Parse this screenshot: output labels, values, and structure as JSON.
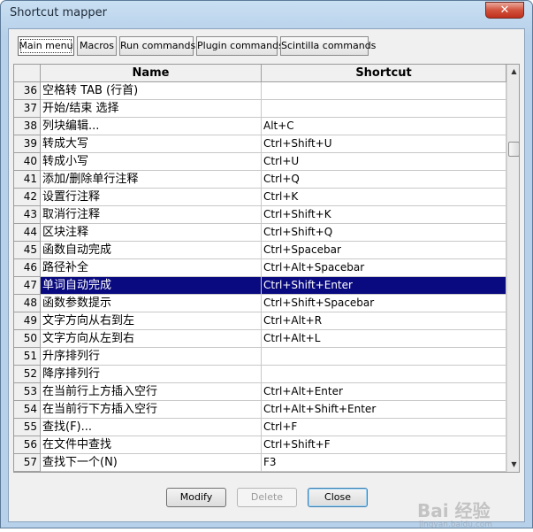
{
  "window": {
    "title": "Shortcut mapper",
    "close_glyph": "✕"
  },
  "tabs": [
    {
      "label": "Main menu",
      "active": true
    },
    {
      "label": "Macros"
    },
    {
      "label": "Run commands"
    },
    {
      "label": "Plugin commands"
    },
    {
      "label": "Scintilla commands"
    }
  ],
  "table": {
    "headers": {
      "name": "Name",
      "shortcut": "Shortcut"
    },
    "selected_row": "47",
    "rows": [
      {
        "num": "36",
        "name": "空格转 TAB (行首)",
        "shortcut": ""
      },
      {
        "num": "37",
        "name": "开始/结束 选择",
        "shortcut": ""
      },
      {
        "num": "38",
        "name": "列块编辑...",
        "shortcut": "Alt+C"
      },
      {
        "num": "39",
        "name": "转成大写",
        "shortcut": "Ctrl+Shift+U"
      },
      {
        "num": "40",
        "name": "转成小写",
        "shortcut": "Ctrl+U"
      },
      {
        "num": "41",
        "name": "添加/删除单行注释",
        "shortcut": "Ctrl+Q"
      },
      {
        "num": "42",
        "name": "设置行注释",
        "shortcut": "Ctrl+K"
      },
      {
        "num": "43",
        "name": "取消行注释",
        "shortcut": "Ctrl+Shift+K"
      },
      {
        "num": "44",
        "name": "区块注释",
        "shortcut": "Ctrl+Shift+Q"
      },
      {
        "num": "45",
        "name": "函数自动完成",
        "shortcut": "Ctrl+Spacebar"
      },
      {
        "num": "46",
        "name": "路径补全",
        "shortcut": "Ctrl+Alt+Spacebar"
      },
      {
        "num": "47",
        "name": "单词自动完成",
        "shortcut": "Ctrl+Shift+Enter"
      },
      {
        "num": "48",
        "name": "函数参数提示",
        "shortcut": "Ctrl+Shift+Spacebar"
      },
      {
        "num": "49",
        "name": "文字方向从右到左",
        "shortcut": "Ctrl+Alt+R"
      },
      {
        "num": "50",
        "name": "文字方向从左到右",
        "shortcut": "Ctrl+Alt+L"
      },
      {
        "num": "51",
        "name": "升序排列行",
        "shortcut": ""
      },
      {
        "num": "52",
        "name": "降序排列行",
        "shortcut": ""
      },
      {
        "num": "53",
        "name": "在当前行上方插入空行",
        "shortcut": "Ctrl+Alt+Enter"
      },
      {
        "num": "54",
        "name": "在当前行下方插入空行",
        "shortcut": "Ctrl+Alt+Shift+Enter"
      },
      {
        "num": "55",
        "name": "查找(F)...",
        "shortcut": "Ctrl+F"
      },
      {
        "num": "56",
        "name": "在文件中查找",
        "shortcut": "Ctrl+Shift+F"
      },
      {
        "num": "57",
        "name": "查找下一个(N)",
        "shortcut": "F3"
      }
    ]
  },
  "scrollbar": {
    "up_glyph": "▲",
    "down_glyph": "▼"
  },
  "buttons": {
    "modify": "Modify",
    "delete": "Delete",
    "close": "Close"
  },
  "watermark": {
    "text": "Bai 经验",
    "sub": "jingyan.baidu.com"
  }
}
